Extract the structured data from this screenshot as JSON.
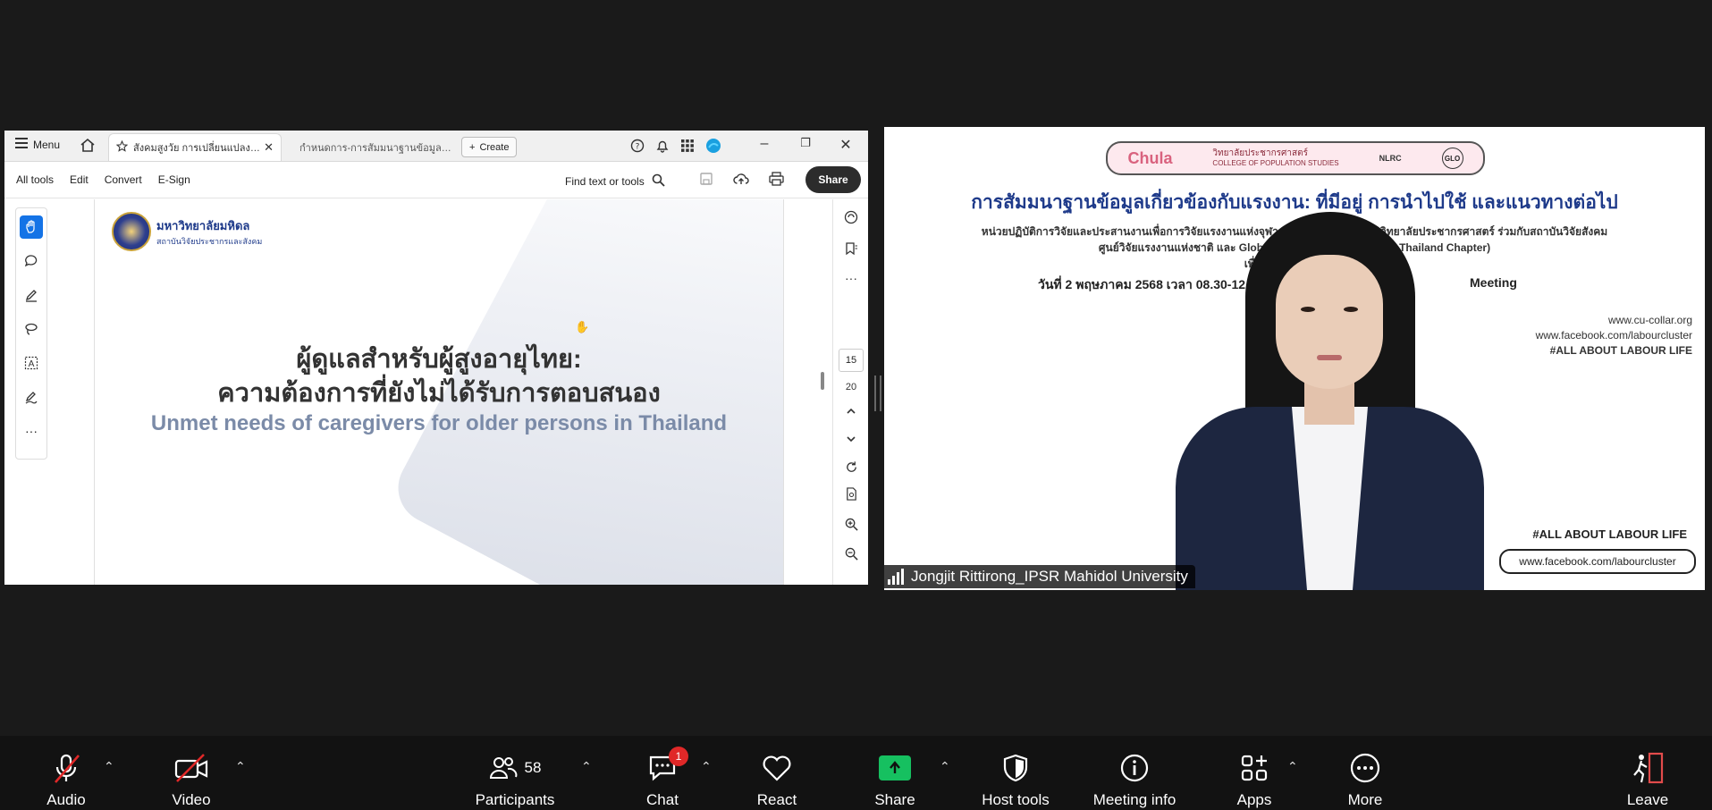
{
  "acrobat": {
    "menu_label": "Menu",
    "tabs": [
      {
        "label": "สังคมสูงวัย การเปลี่ยนแปลงเชิ...",
        "active": true
      },
      {
        "label": "กำหนดการ-การสัมมนาฐานข้อมูลด้านแร...",
        "active": false
      }
    ],
    "create_label": "Create",
    "tools": [
      "All tools",
      "Edit",
      "Convert",
      "E-Sign"
    ],
    "find_placeholder": "Find text or tools",
    "share_label": "Share",
    "page_numbers": [
      "15",
      "20"
    ]
  },
  "slide": {
    "logo_main": "มหาวิทยาลัยมหิดล",
    "logo_sub": "สถาบันวิจัยประชากรและสังคม",
    "title_th_1": "ผู้ดูแลสำหรับผู้สูงอายุไทย:",
    "title_th_2": "ความต้องการที่ยังไม่ได้รับการตอบสนอง",
    "title_en": "Unmet needs of caregivers  for older persons in Thailand"
  },
  "video": {
    "logo_chula": "Chula",
    "logo_cps_th": "วิทยาลัยประชากรศาสตร์",
    "logo_cps_en": "COLLEGE OF POPULATION STUDIES",
    "logo_nlrc": "NLRC",
    "logo_glo": "GLO",
    "title": "การสัมมนาฐานข้อมูลเกี่ยวข้องกับแรงงาน: ที่มีอยู่ การนำไปใช้ และแนวทางต่อไป",
    "line1": "หน่วยปฏิบัติการวิจัยและประสานงานเพื่อการวิจัยแรงงานแห่งจุฬาลงกรณ์มหาวิทยาลัย (          วิทยาลัยประชากรศาสตร์ ร่วมกับสถาบันวิจัยสังคม",
    "line2": "ศูนย์วิจัยแรงงานแห่งชาติ  และ Global Labour Organization                               nd Thailand Chapter)",
    "line3": "เพื่อสัปดาห์วันแรงงาน",
    "date_line": "วันที่ 2 พฤษภาคม 2568  เวลา 08.30-12.00 น.",
    "meeting_word": "Meeting",
    "url1": "www.cu-collar.org",
    "url2": "www.facebook.com/labourcluster",
    "tag1": "#ALL ABOUT LABOUR LIFE",
    "tag2": "#ALL ABOUT LABOUR LIFE",
    "url3": "www.facebook.com/labourcluster",
    "speaker_name": "Jongjit Rittirong_IPSR Mahidol University"
  },
  "meeting_bar": {
    "audio": "Audio",
    "video": "Video",
    "participants": "Participants",
    "participant_count": "58",
    "chat": "Chat",
    "chat_badge": "1",
    "react": "React",
    "share": "Share",
    "host_tools": "Host tools",
    "meeting_info": "Meeting info",
    "apps": "Apps",
    "more": "More",
    "leave": "Leave"
  },
  "colors": {
    "acrobat_accent": "#1473e6",
    "share_green": "#16c060",
    "badge_red": "#e02828",
    "title_blue": "#1e3a8a"
  }
}
